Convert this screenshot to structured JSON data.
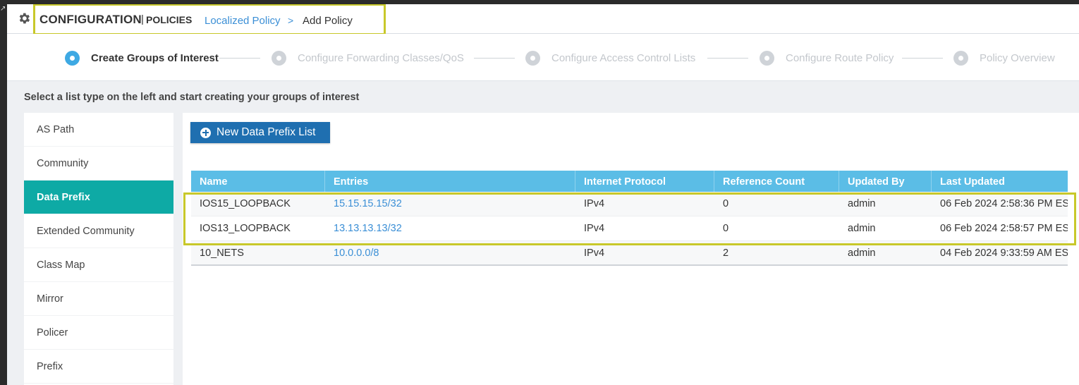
{
  "header": {
    "title": "CONFIGURATION",
    "separator": "|",
    "subtitle": "POLICIES",
    "breadcrumb_link": "Localized Policy",
    "breadcrumb_chevron": ">",
    "breadcrumb_current": "Add Policy"
  },
  "stepper": {
    "steps": [
      {
        "label": "Create Groups of Interest",
        "active": true
      },
      {
        "label": "Configure Forwarding Classes/QoS",
        "active": false
      },
      {
        "label": "Configure Access Control Lists",
        "active": false
      },
      {
        "label": "Configure Route Policy",
        "active": false
      },
      {
        "label": "Policy Overview",
        "active": false
      }
    ]
  },
  "instruction": "Select a list type on the left and start creating your groups of interest",
  "sidebar": {
    "items": [
      {
        "label": "AS Path"
      },
      {
        "label": "Community"
      },
      {
        "label": "Data Prefix"
      },
      {
        "label": "Extended Community"
      },
      {
        "label": "Class Map"
      },
      {
        "label": "Mirror"
      },
      {
        "label": "Policer"
      },
      {
        "label": "Prefix"
      }
    ],
    "active_index": 2
  },
  "main": {
    "new_button_label": "New Data Prefix List",
    "table": {
      "columns": [
        "Name",
        "Entries",
        "Internet Protocol",
        "Reference Count",
        "Updated By",
        "Last Updated"
      ],
      "rows": [
        {
          "name": "IOS15_LOOPBACK",
          "entries": "15.15.15.15/32",
          "protocol": "IPv4",
          "ref_count": "0",
          "updated_by": "admin",
          "last_updated": "06 Feb 2024 2:58:36 PM ES"
        },
        {
          "name": "IOS13_LOOPBACK",
          "entries": "13.13.13.13/32",
          "protocol": "IPv4",
          "ref_count": "0",
          "updated_by": "admin",
          "last_updated": "06 Feb 2024 2:58:57 PM ES"
        },
        {
          "name": "10_NETS",
          "entries": "10.0.0.0/8",
          "protocol": "IPv4",
          "ref_count": "2",
          "updated_by": "admin",
          "last_updated": "04 Feb 2024 9:33:59 AM ES"
        }
      ]
    }
  },
  "colors": {
    "accent_blue": "#3ea9e3",
    "table_header": "#5bbde6",
    "sidebar_active": "#0eaaa5",
    "button": "#1f6fb0",
    "highlight_box": "#c8c82a",
    "link": "#3b8fd6"
  },
  "icons": {
    "header": "gear-icon",
    "button": "plus-circle-icon",
    "step": "radio-dot-icon"
  }
}
